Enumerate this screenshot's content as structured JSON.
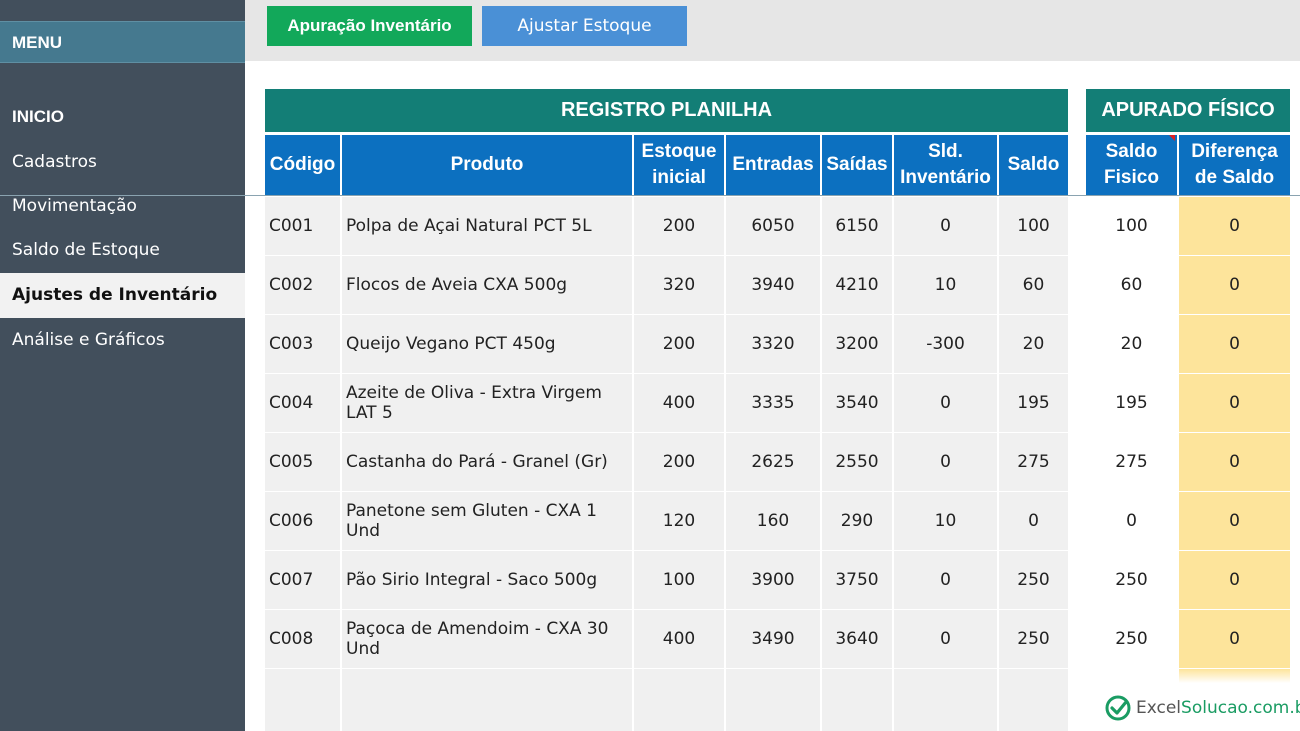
{
  "sidebar": {
    "menu_label": "MENU",
    "items": [
      {
        "label": "INICIO"
      },
      {
        "label": "Cadastros"
      },
      {
        "label": "Movimentação"
      },
      {
        "label": "Saldo de Estoque"
      },
      {
        "label": "Ajustes de Inventário"
      },
      {
        "label": "Análise e Gráficos"
      }
    ],
    "active_index": 4
  },
  "toolbar": {
    "apuracao_label": "Apuração Inventário",
    "ajustar_label": "Ajustar Estoque"
  },
  "registro": {
    "title": "REGISTRO PLANILHA",
    "headers": [
      "Código",
      "Produto",
      "Estoque inicial",
      "Entradas",
      "Saídas",
      "Sld. Inventário",
      "Saldo"
    ]
  },
  "apurado": {
    "title": "APURADO FÍSICO",
    "headers": [
      "Saldo Fisico",
      "Diferença de Saldo"
    ]
  },
  "rows": [
    {
      "codigo": "C001",
      "produto": "Polpa de Açai Natural PCT 5L",
      "estoque_inicial": "200",
      "entradas": "6050",
      "saidas": "6150",
      "sld_inventario": "0",
      "saldo": "100",
      "saldo_fisico": "100",
      "diferenca": "0"
    },
    {
      "codigo": "C002",
      "produto": "Flocos de Aveia CXA 500g",
      "estoque_inicial": "320",
      "entradas": "3940",
      "saidas": "4210",
      "sld_inventario": "10",
      "saldo": "60",
      "saldo_fisico": "60",
      "diferenca": "0"
    },
    {
      "codigo": "C003",
      "produto": "Queijo Vegano PCT 450g",
      "estoque_inicial": "200",
      "entradas": "3320",
      "saidas": "3200",
      "sld_inventario": "-300",
      "saldo": "20",
      "saldo_fisico": "20",
      "diferenca": "0"
    },
    {
      "codigo": "C004",
      "produto": "Azeite de Oliva - Extra Virgem LAT 5",
      "estoque_inicial": "400",
      "entradas": "3335",
      "saidas": "3540",
      "sld_inventario": "0",
      "saldo": "195",
      "saldo_fisico": "195",
      "diferenca": "0"
    },
    {
      "codigo": "C005",
      "produto": "Castanha do Pará - Granel (Gr)",
      "estoque_inicial": "200",
      "entradas": "2625",
      "saidas": "2550",
      "sld_inventario": "0",
      "saldo": "275",
      "saldo_fisico": "275",
      "diferenca": "0"
    },
    {
      "codigo": "C006",
      "produto": "Panetone sem Gluten - CXA 1 Und",
      "estoque_inicial": "120",
      "entradas": "160",
      "saidas": "290",
      "sld_inventario": "10",
      "saldo": "0",
      "saldo_fisico": "0",
      "diferenca": "0"
    },
    {
      "codigo": "C007",
      "produto": "Pão Sirio Integral - Saco 500g",
      "estoque_inicial": "100",
      "entradas": "3900",
      "saidas": "3750",
      "sld_inventario": "0",
      "saldo": "250",
      "saldo_fisico": "250",
      "diferenca": "0"
    },
    {
      "codigo": "C008",
      "produto": "Paçoca de Amendoim - CXA 30 Und",
      "estoque_inicial": "400",
      "entradas": "3490",
      "saidas": "3640",
      "sld_inventario": "0",
      "saldo": "250",
      "saldo_fisico": "250",
      "diferenca": "0"
    }
  ],
  "footer": {
    "logo_prefix": "Excel",
    "logo_suffix": "Solucao.com.br"
  },
  "colors": {
    "sidebar_bg": "#424f5c",
    "menu_bar": "#45798f",
    "section_header": "#137e76",
    "column_header": "#0c70c0",
    "apuracao_button": "#12a85a",
    "ajustar_button": "#4a90d6",
    "diferenca_fill": "#fde49b"
  }
}
